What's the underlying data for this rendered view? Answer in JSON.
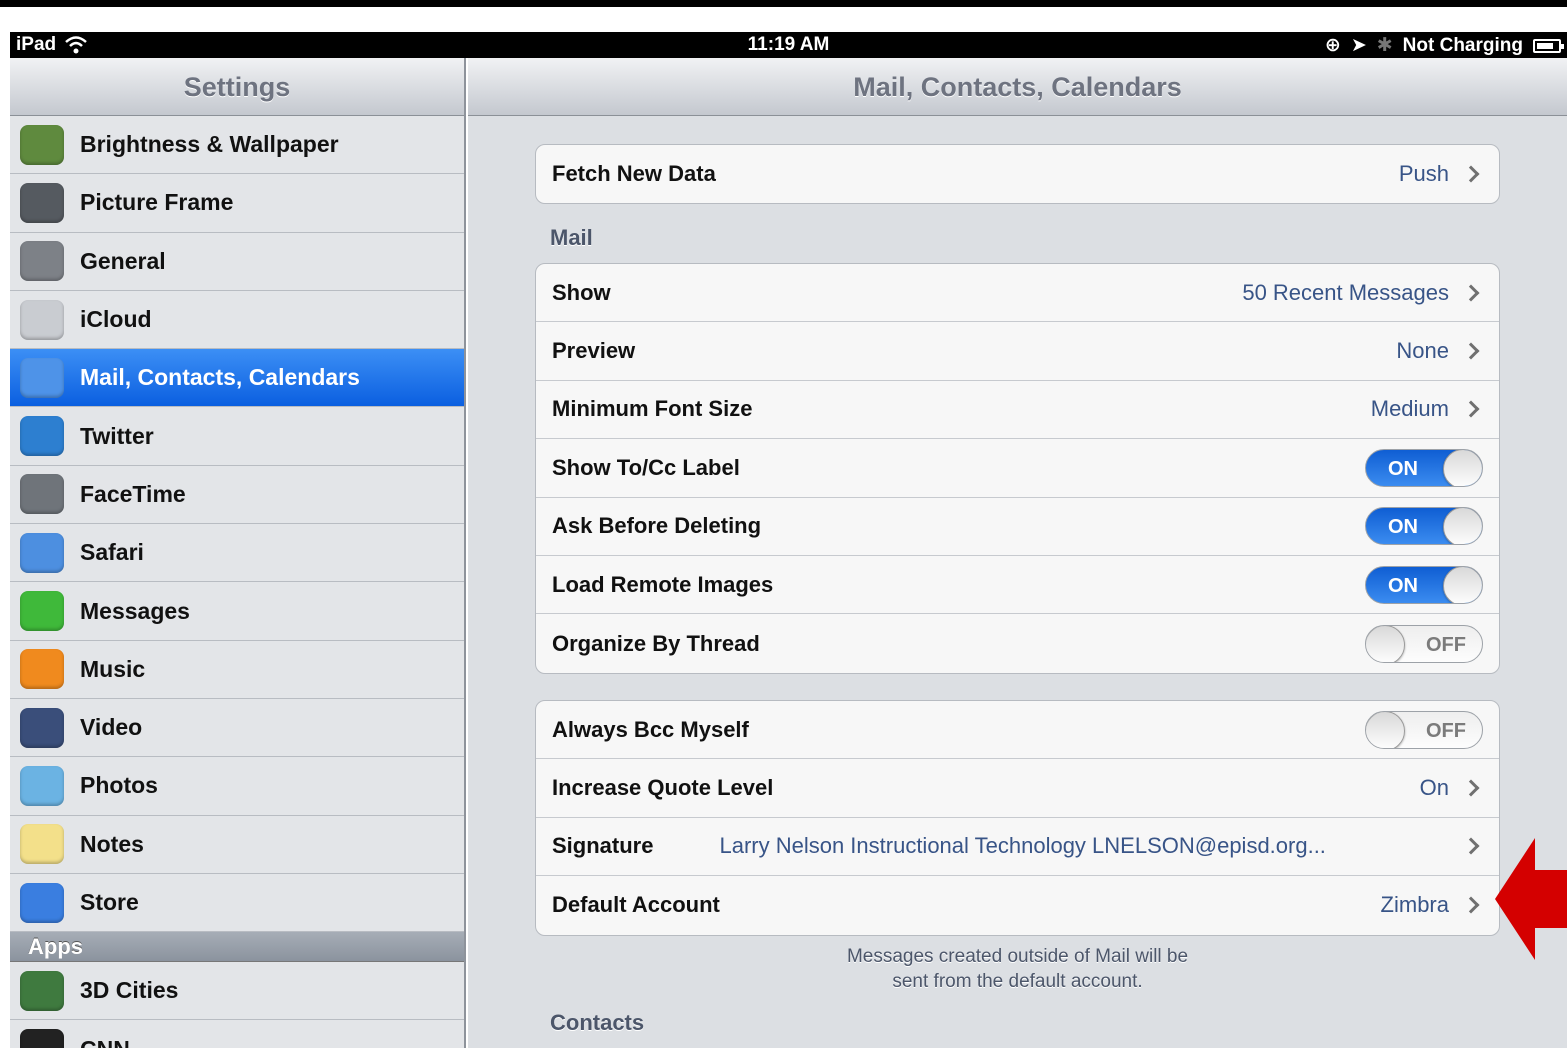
{
  "status_bar": {
    "device": "iPad",
    "time": "11:19 AM",
    "charging": "Not Charging"
  },
  "sidebar": {
    "title": "Settings",
    "items": [
      {
        "label": "Brightness & Wallpaper",
        "icon": "flower-icon",
        "color": "#5f8a3e"
      },
      {
        "label": "Picture Frame",
        "icon": "picture-frame-icon",
        "color": "#555a60"
      },
      {
        "label": "General",
        "icon": "gear-icon",
        "color": "#7d8187"
      },
      {
        "label": "iCloud",
        "icon": "cloud-icon",
        "color": "#c9ccd1"
      },
      {
        "label": "Mail, Contacts, Calendars",
        "icon": "envelope-icon",
        "color": "#4e93e8",
        "selected": true
      },
      {
        "label": "Twitter",
        "icon": "bird-icon",
        "color": "#2d7fd0"
      },
      {
        "label": "FaceTime",
        "icon": "camera-icon",
        "color": "#6f747a"
      },
      {
        "label": "Safari",
        "icon": "compass-icon",
        "color": "#4d8fe0"
      },
      {
        "label": "Messages",
        "icon": "speech-bubble-icon",
        "color": "#3fb93a"
      },
      {
        "label": "Music",
        "icon": "music-note-icon",
        "color": "#f08a1e"
      },
      {
        "label": "Video",
        "icon": "clapperboard-icon",
        "color": "#3a4e7a"
      },
      {
        "label": "Photos",
        "icon": "sunflower-icon",
        "color": "#6bb3e3"
      },
      {
        "label": "Notes",
        "icon": "notepad-icon",
        "color": "#f3e08a"
      },
      {
        "label": "Store",
        "icon": "app-store-icon",
        "color": "#3a7ee0"
      }
    ],
    "apps_header": "Apps",
    "apps": [
      {
        "label": "3D Cities",
        "icon": "cities-icon",
        "color": "#3f7a3f"
      },
      {
        "label": "CNN",
        "icon": "cnn-icon",
        "color": "#222222"
      }
    ]
  },
  "main": {
    "title": "Mail, Contacts, Calendars",
    "fetch": {
      "label": "Fetch New Data",
      "value": "Push"
    },
    "mail_section": "Mail",
    "mail_rows": [
      {
        "label": "Show",
        "value": "50 Recent Messages"
      },
      {
        "label": "Preview",
        "value": "None"
      },
      {
        "label": "Minimum Font Size",
        "value": "Medium"
      }
    ],
    "toggles": [
      {
        "label": "Show To/Cc Label",
        "state": "ON"
      },
      {
        "label": "Ask Before Deleting",
        "state": "ON"
      },
      {
        "label": "Load Remote Images",
        "state": "ON"
      },
      {
        "label": "Organize By Thread",
        "state": "OFF"
      }
    ],
    "group2": {
      "bcc": {
        "label": "Always Bcc Myself",
        "state": "OFF"
      },
      "quote": {
        "label": "Increase Quote Level",
        "value": "On"
      },
      "signature": {
        "label": "Signature",
        "value": "Larry Nelson Instructional Technology LNELSON@episd.org..."
      },
      "default_account": {
        "label": "Default Account",
        "value": "Zimbra"
      }
    },
    "footnote_line1": "Messages created outside of Mail will be",
    "footnote_line2": "sent from the default account.",
    "contacts_section": "Contacts"
  },
  "annotation": {
    "arrow_color": "#d40000"
  }
}
